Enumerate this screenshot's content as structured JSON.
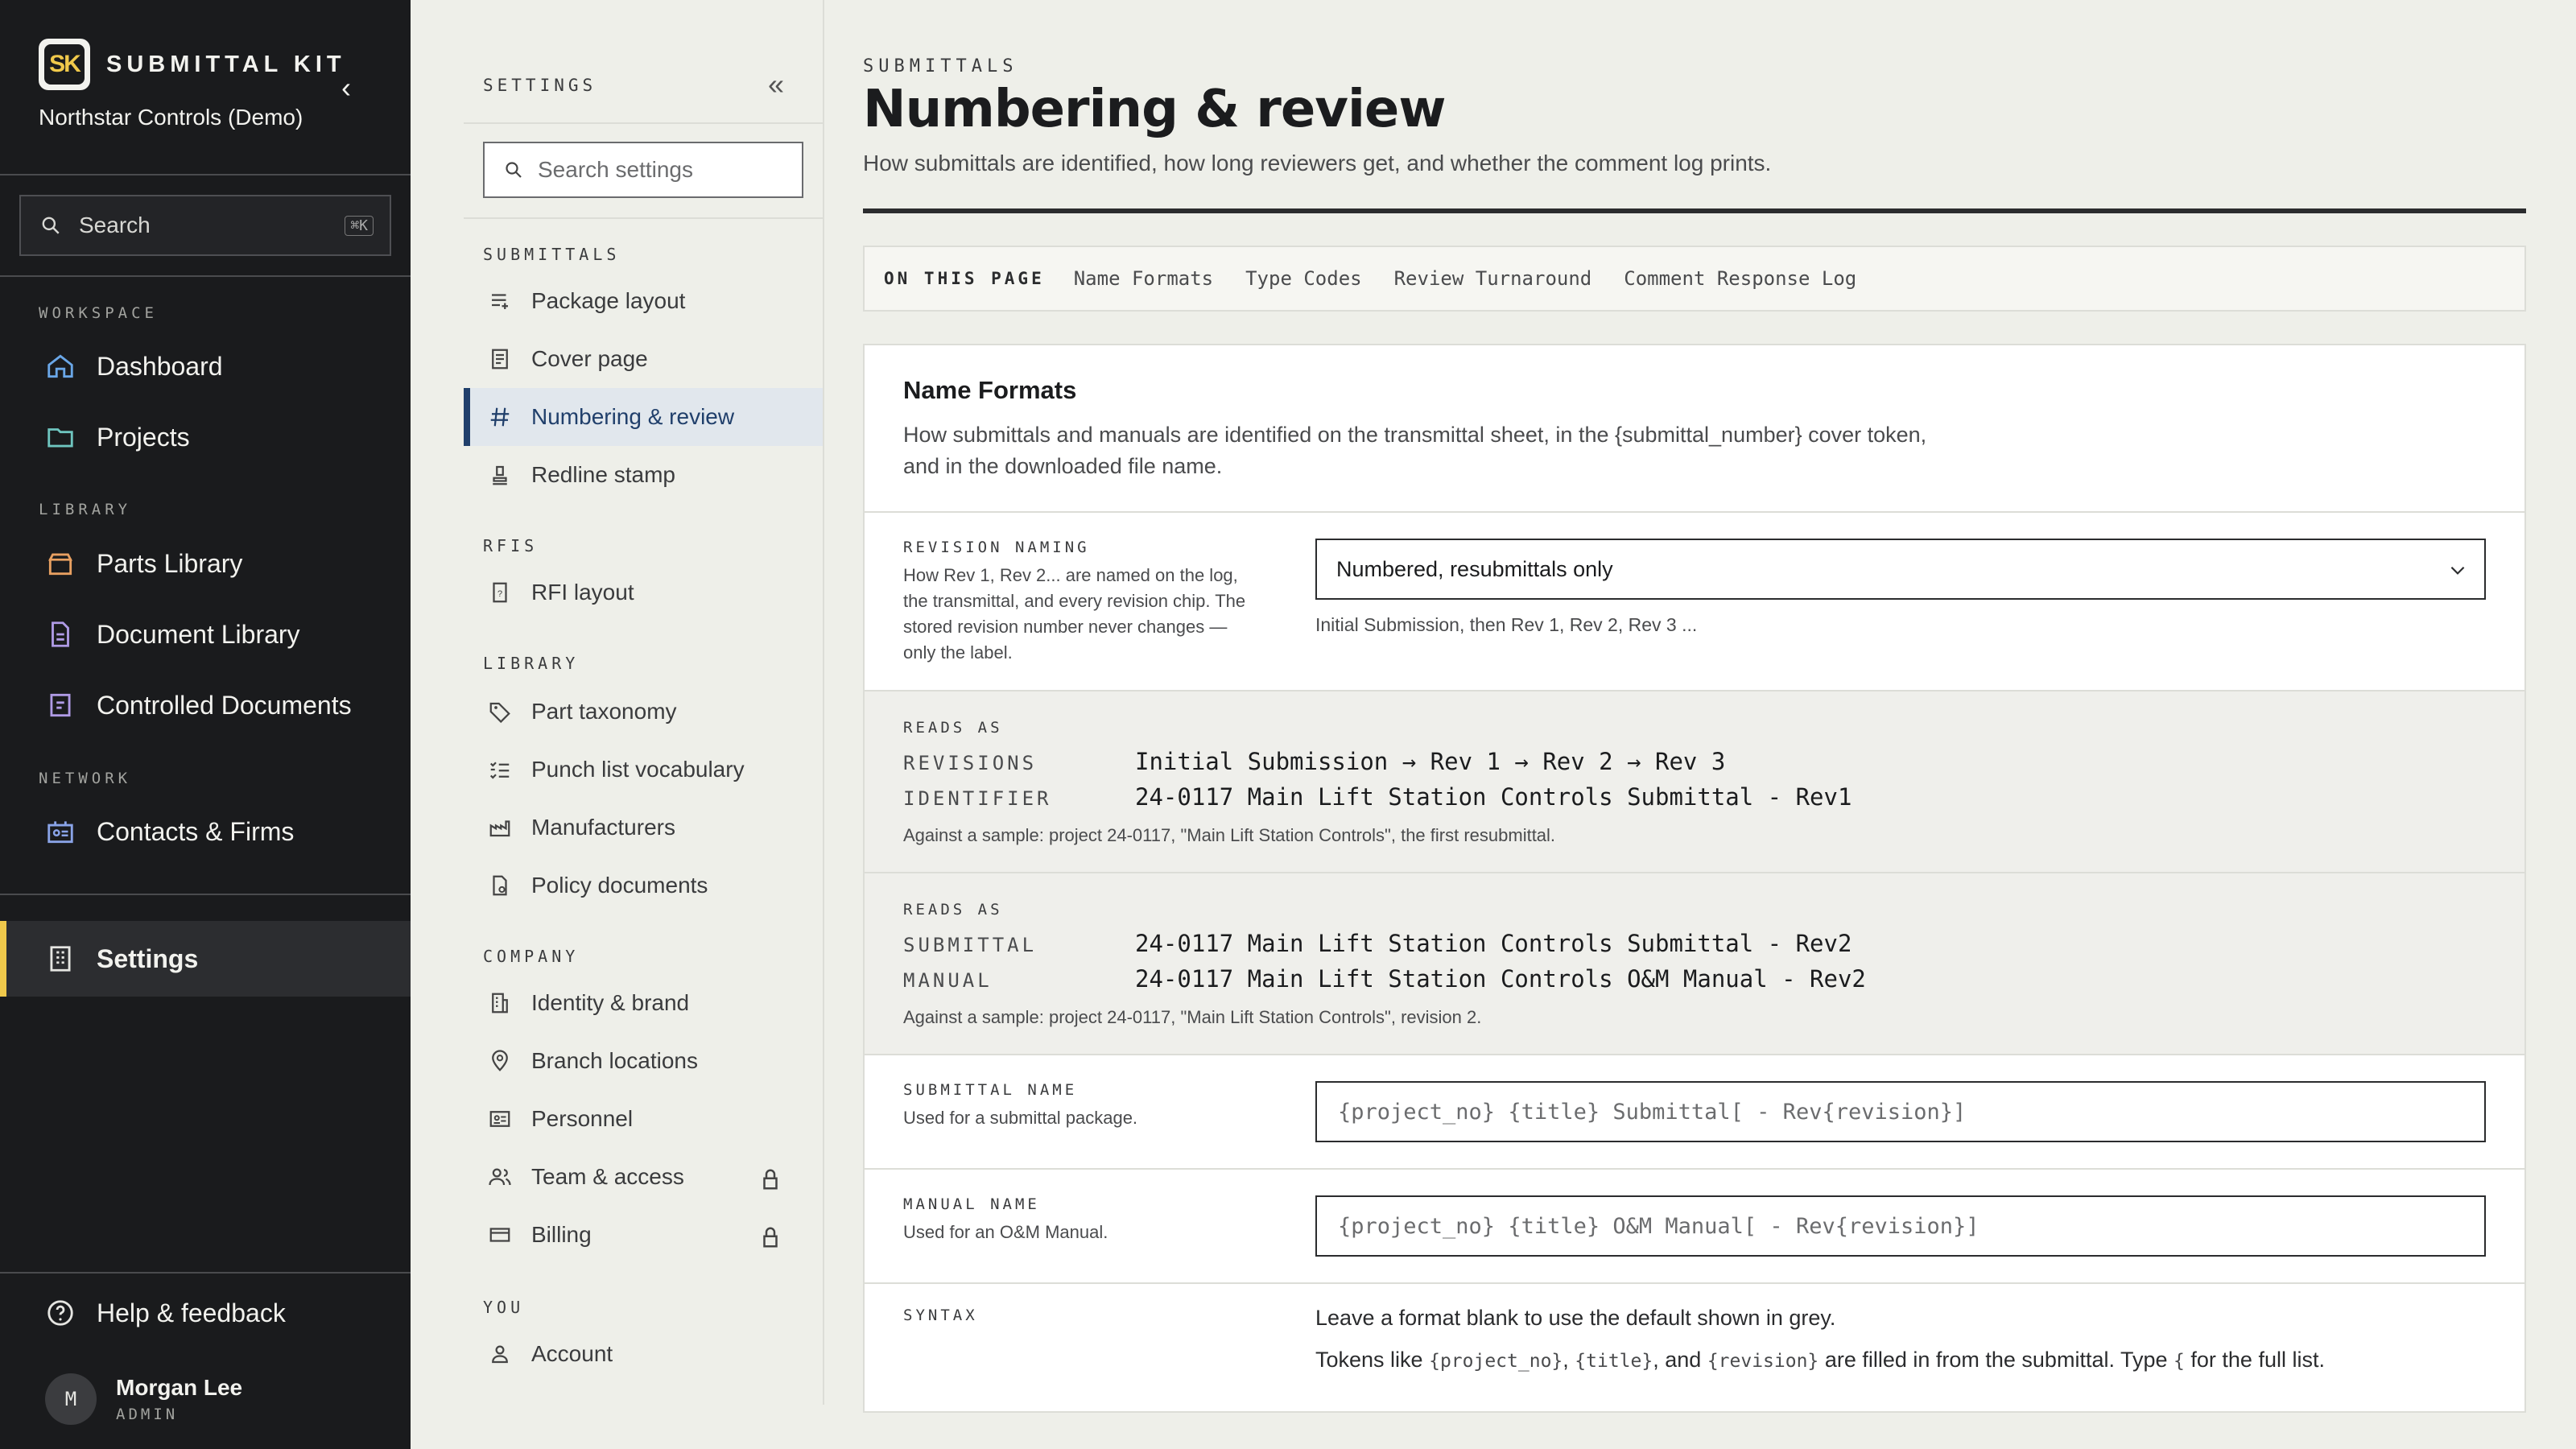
{
  "app": {
    "logo_text": "SK",
    "name": "SUBMITTAL KIT",
    "org": "Northstar Controls (Demo)"
  },
  "sidebar": {
    "search_label": "Search",
    "search_kbd": "⌘K",
    "workspace_label": "WORKSPACE",
    "library_label": "LIBRARY",
    "network_label": "NETWORK",
    "items": {
      "dashboard": "Dashboard",
      "projects": "Projects",
      "parts": "Parts Library",
      "documents": "Document Library",
      "controlled": "Controlled Documents",
      "contacts": "Contacts & Firms",
      "settings": "Settings",
      "help": "Help & feedback"
    },
    "user": {
      "initial": "M",
      "name": "Morgan Lee",
      "role": "ADMIN"
    }
  },
  "settings_nav": {
    "title": "SETTINGS",
    "search_placeholder": "Search settings",
    "groups": {
      "submittals": "SUBMITTALS",
      "rfis": "RFIS",
      "library": "LIBRARY",
      "company": "COMPANY",
      "you": "YOU"
    },
    "items": {
      "package": "Package layout",
      "cover": "Cover page",
      "numbering": "Numbering & review",
      "redline": "Redline stamp",
      "rfi": "RFI layout",
      "taxonomy": "Part taxonomy",
      "punch": "Punch list vocabulary",
      "manufacturers": "Manufacturers",
      "policy": "Policy documents",
      "identity": "Identity & brand",
      "branches": "Branch locations",
      "personnel": "Personnel",
      "team": "Team & access",
      "billing": "Billing",
      "account": "Account"
    }
  },
  "page": {
    "eyebrow": "SUBMITTALS",
    "title": "Numbering & review",
    "lead": "How submittals are identified, how long reviewers get, and whether the comment log prints.",
    "on_this_page": {
      "label": "ON THIS PAGE",
      "links": [
        "Name Formats",
        "Type Codes",
        "Review Turnaround",
        "Comment Response Log"
      ]
    }
  },
  "card": {
    "title": "Name Formats",
    "desc1": "How submittals and manuals are identified on the transmittal sheet, in the {submittal_number} cover token,",
    "desc2": "and in the downloaded file name.",
    "revision": {
      "label": "REVISION NAMING",
      "help": "How Rev 1, Rev 2... are named on the log, the transmittal, and every revision chip. The stored revision number never changes — only the label.",
      "value": "Numbered, resubmittals only",
      "hint": "Initial Submission, then Rev 1, Rev 2, Rev 3 ..."
    },
    "reads1": {
      "label": "READS AS",
      "k1": "REVISIONS",
      "v1": "Initial Submission → Rev 1 → Rev 2 → Rev 3",
      "k2": "IDENTIFIER",
      "v2": "24-0117 Main Lift Station Controls Submittal - Rev1",
      "sample": "Against a sample: project 24-0117, \"Main Lift Station Controls\", the first resubmittal."
    },
    "reads2": {
      "label": "READS AS",
      "k1": "SUBMITTAL",
      "v1": "24-0117 Main Lift Station Controls Submittal - Rev2",
      "k2": "MANUAL",
      "v2": "24-0117 Main Lift Station Controls O&M Manual - Rev2",
      "sample": "Against a sample: project 24-0117, \"Main Lift Station Controls\", revision 2."
    },
    "submittal_name": {
      "label": "SUBMITTAL NAME",
      "help": "Used for a submittal package.",
      "placeholder": "{project_no} {title} Submittal[ - Rev{revision}]"
    },
    "manual_name": {
      "label": "MANUAL NAME",
      "help": "Used for an O&M Manual.",
      "placeholder": "{project_no} {title} O&M Manual[ - Rev{revision}]"
    },
    "syntax": {
      "label": "SYNTAX",
      "line1": "Leave a format blank to use the default shown in grey.",
      "t_pre": "Tokens like",
      "tok1": "{project_no}",
      "tok2": "{title}",
      "tok3": "{revision}",
      "t_and": "and",
      "t_post": "are filled in from the submittal. Type",
      "brace": "{",
      "t_end": "for the full list."
    }
  }
}
